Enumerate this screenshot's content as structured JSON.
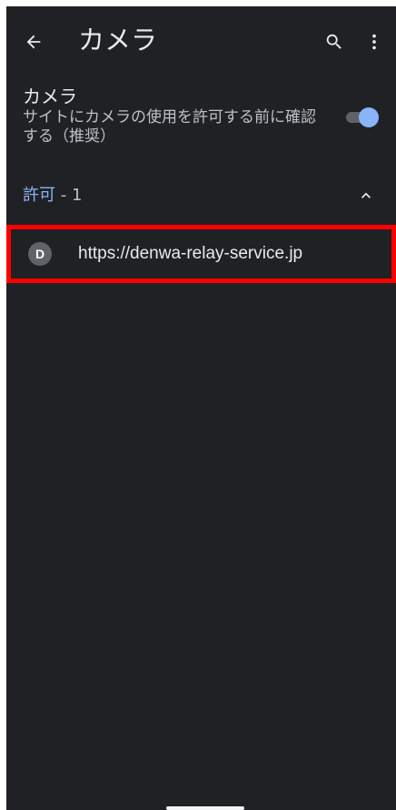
{
  "appbar": {
    "title": "カメラ",
    "back_icon": "arrow-back-icon",
    "search_icon": "search-icon",
    "more_icon": "more-vert-icon"
  },
  "camera_setting": {
    "title": "カメラ",
    "summary": "サイトにカメラの使用を許可する前に確認する（推奨）",
    "enabled": true
  },
  "allowed_section": {
    "label": "許可",
    "count_text": " - 1",
    "collapse_icon": "chevron-up-icon"
  },
  "sites": [
    {
      "favicon_letter": "D",
      "url": "https://denwa-relay-service.jp"
    }
  ],
  "colors": {
    "background": "#202124",
    "accent": "#8ab4f8",
    "highlight": "#ff0000"
  }
}
